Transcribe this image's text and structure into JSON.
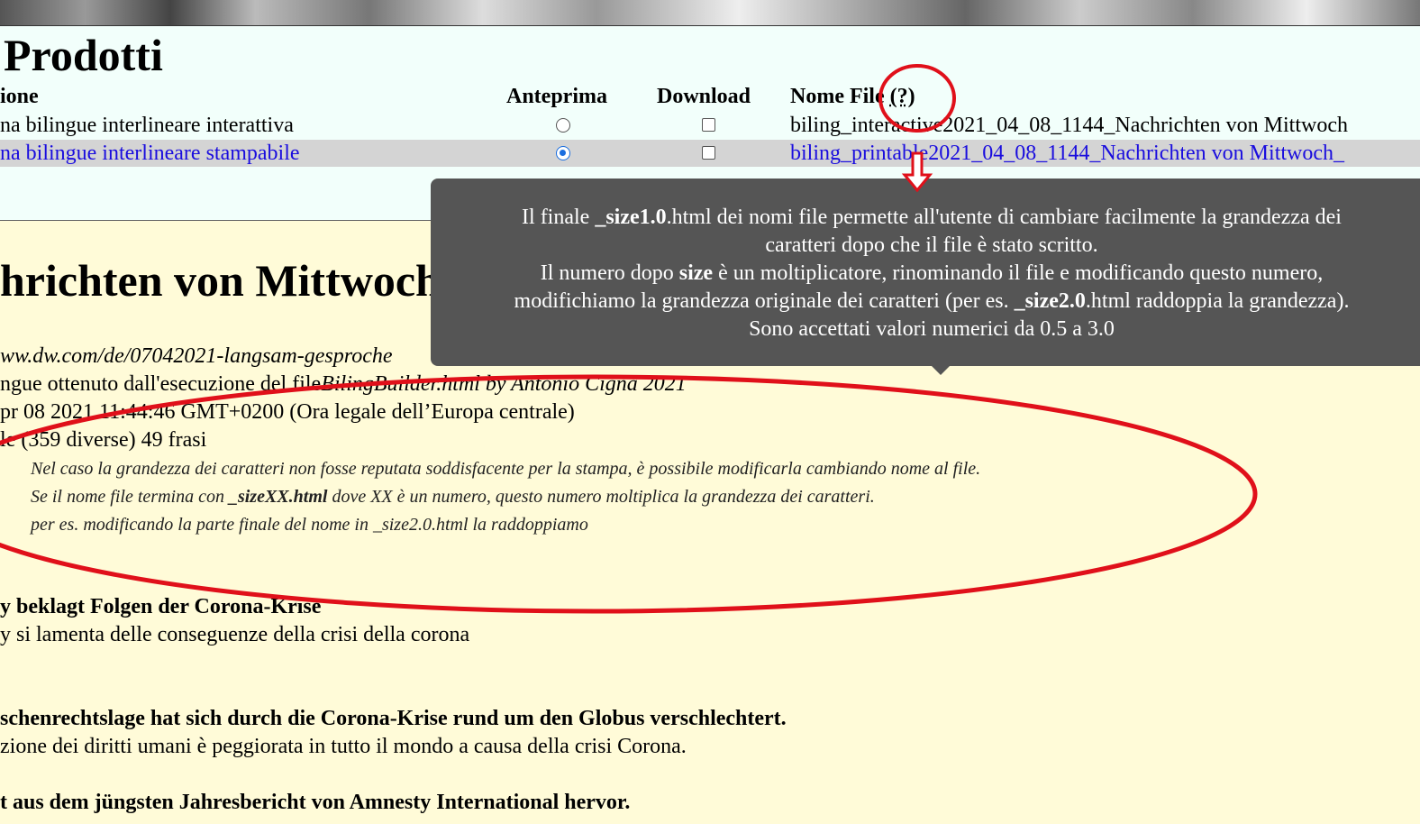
{
  "products": {
    "title": "Prodotti",
    "headers": {
      "description": "ione",
      "preview": "Anteprima",
      "download": "Download",
      "filename": "Nome File",
      "help": "(?)"
    },
    "rows": [
      {
        "description": "na bilingue interlineare interattiva",
        "filename": "biling_interactive2021_04_08_1144_Nachrichten von Mittwoch",
        "preview_selected": false,
        "download_checked": false
      },
      {
        "description": "na bilingue interlineare stampabile",
        "filename": "biling_printable2021_04_08_1144_Nachrichten von Mittwoch_",
        "preview_selected": true,
        "download_checked": false
      }
    ]
  },
  "tooltip": {
    "line1_a": "Il finale ",
    "line1_b": "_size1.0",
    "line1_c": ".html dei nomi file permette all'utente di cambiare facilmente la grandezza dei",
    "line2": "caratteri dopo che il file è stato scritto.",
    "line3_a": "Il numero dopo ",
    "line3_b": "size",
    "line3_c": " è un moltiplicatore, rinominando il file e modificando questo numero,",
    "line4_a": "modifichiamo la grandezza originale dei caratteri (per es. ",
    "line4_b": "_size2.0",
    "line4_c": ".html raddoppia la grandezza).",
    "line5": "Sono accettati valori numerici da 0.5 a 3.0"
  },
  "document": {
    "title": "hrichten von Mittwoch",
    "source_url": "ww.dw.com/de/07042021-langsam-gesproche",
    "generated_prefix": "ngue ottenuto dall'esecuzione del file",
    "generated_file": "BilingBuilder.html by Antonio Cigna 2021",
    "date": "pr 08 2021 11:44:46 GMT+0200 (Ora legale dell’Europa centrale)",
    "stats": "le (359 diverse) 49 frasi",
    "notes": {
      "n1": "Nel caso la grandezza dei caratteri non fosse reputata soddisfacente per la stampa, è possibile modificarla cambiando nome al file.",
      "n2_a": "Se il nome file termina con ",
      "n2_b": "_sizeXX.html",
      "n2_c": " dove XX è un numero, questo numero moltiplica la grandezza dei caratteri.",
      "n3": "per es. modificando la parte finale del nome in _size2.0.html la raddoppiamo"
    },
    "sentences": [
      {
        "de": "y beklagt Folgen der Corona-Krise",
        "it": "y si lamenta delle conseguenze della crisi della corona"
      },
      {
        "de": "schenrechtslage hat sich durch die Corona-Krise rund um den Globus verschlechtert.",
        "it": "zione dei diritti umani è peggiorata in tutto il mondo a causa della crisi Corona."
      },
      {
        "de": "t aus dem jüngsten Jahresbericht von Amnesty International hervor.",
        "it": ""
      }
    ]
  },
  "colors": {
    "link_blue": "#1a0dde",
    "annotation_red": "#e0101a",
    "tooltip_bg": "#555555",
    "header_bg": "#f2fffb",
    "content_bg": "#fffbd8"
  }
}
